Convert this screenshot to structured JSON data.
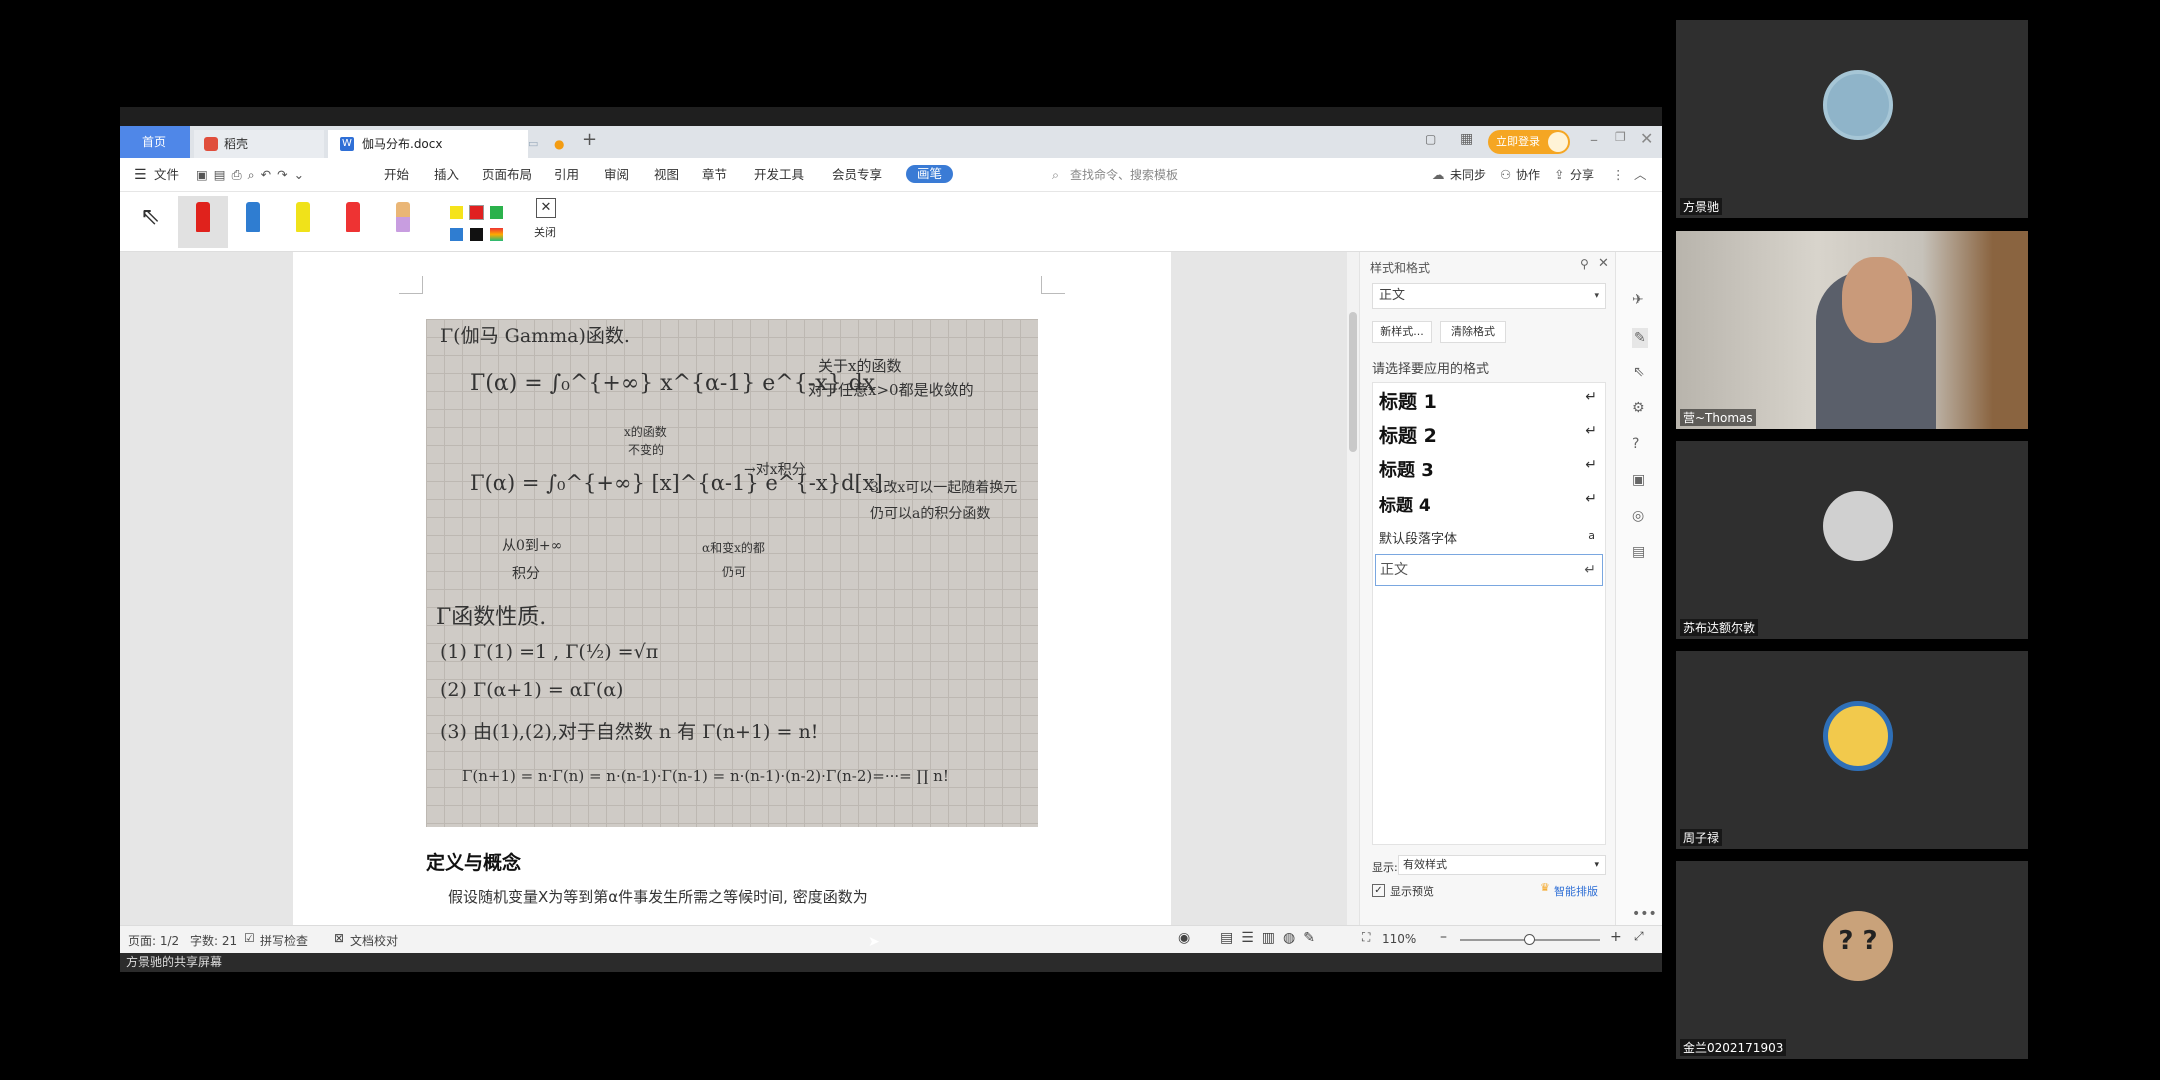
{
  "app": {
    "tabs": {
      "home": "首页",
      "daoke": "稻壳",
      "doc": "伽马分布.docx"
    },
    "login_btn": "立即登录",
    "menu": {
      "file": "文件",
      "items": [
        "开始",
        "插入",
        "页面布局",
        "引用",
        "审阅",
        "视图",
        "章节",
        "开发工具",
        "会员专享"
      ],
      "pen": "画笔",
      "search_placeholder": "查找命令、搜索模板",
      "sync": "未同步",
      "collab": "协作",
      "share": "分享"
    },
    "toolbar": {
      "close_label": "关闭"
    }
  },
  "document": {
    "handwriting": {
      "title": "Γ(伽马 Gamma)函数.",
      "eq1": "Γ(α) = ∫₀^{+∞} x^{α-1} e^{-x} dx",
      "note1a": "关于x的函数",
      "note1b": "对于任意x>0都是收敛的",
      "note_top": "x的函数",
      "note_top2": "不变的",
      "eq2": "Γ(α) = ∫₀^{+∞} [x]^{α-1} e^{-x}d[x]",
      "arrow_note": "→对x积分",
      "note2a": "3.改x可以一起随着换元",
      "note2b": "仍可以a的积分函数",
      "note3a": "从0到+∞",
      "note3b": "积分",
      "note4a": "α和变x的都",
      "note4b": "仍可",
      "sec": "Γ函数性质.",
      "p1": "(1) Γ(1) =1 , Γ(½) =√π",
      "p2": "(2) Γ(α+1) = αΓ(α)",
      "p3": "(3) 由(1),(2),对于自然数 n 有 Γ(n+1) = n!",
      "p4": "Γ(n+1) = n·Γ(n) = n·(n-1)·Γ(n-1) = n·(n-1)·(n-2)·Γ(n-2)=···= ∏ n!"
    },
    "heading": "定义与概念",
    "paragraph": "假设随机变量X为等到第α件事发生所需之等候时间, 密度函数为"
  },
  "panel": {
    "title": "样式和格式",
    "current_style": "正文",
    "new_style": "新样式...",
    "clear_style": "清除格式",
    "prompt": "请选择要应用的格式",
    "styles": [
      "标题 1",
      "标题 2",
      "标题 3",
      "标题 4"
    ],
    "default_font": "默认段落字体",
    "body": "正文",
    "show_label": "显示:",
    "show_value": "有效样式",
    "preview": "显示预览",
    "smart": "智能排版"
  },
  "status": {
    "page": "页面: 1/2",
    "words": "字数: 21",
    "spell": "拼写检查",
    "proof": "文档校对",
    "zoom": "110%",
    "share_label": "方景驰的共享屏幕"
  },
  "participants": [
    {
      "name": "方景驰",
      "avatar_color": "#8fb4c9"
    },
    {
      "name": "营~Thomas",
      "avatar_color": "#c9c2b6"
    },
    {
      "name": "苏布达额尔敦",
      "avatar_color": "#d0d0d0"
    },
    {
      "name": "周子禄",
      "avatar_color": "#f2c94c"
    },
    {
      "name": "金兰0202171903",
      "avatar_color": "#c9a27a"
    }
  ]
}
